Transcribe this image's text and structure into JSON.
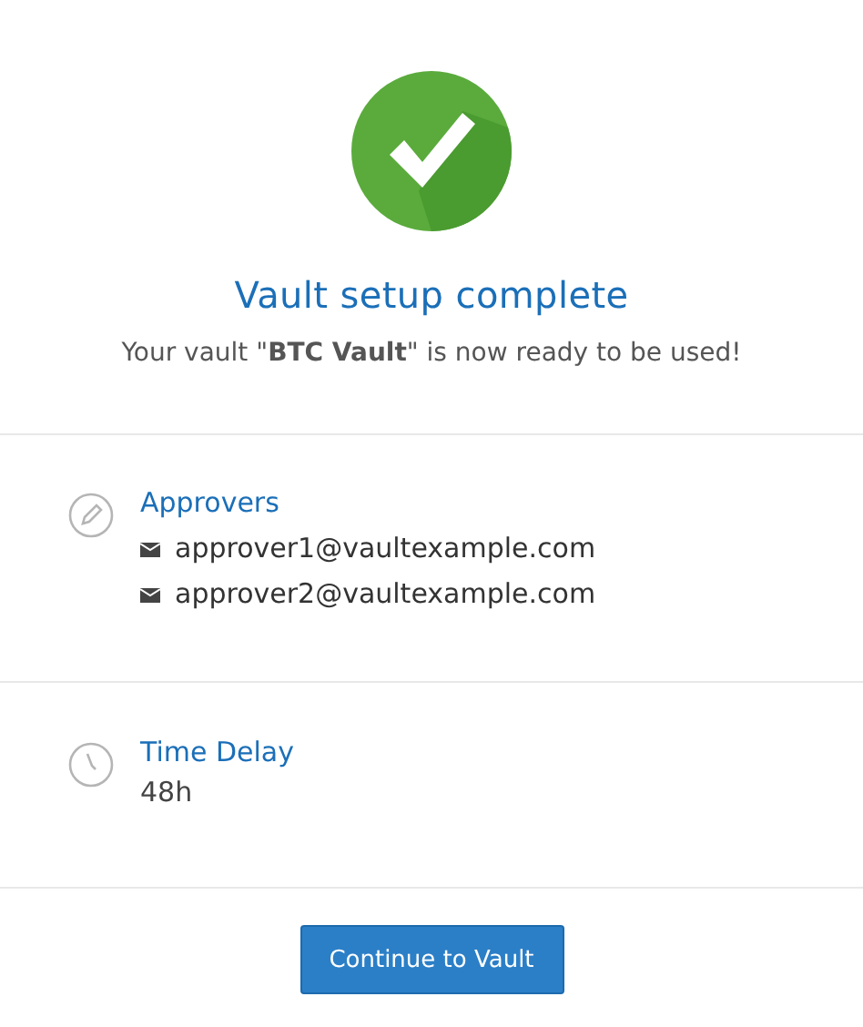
{
  "header": {
    "title": "Vault setup complete",
    "message": "Your vault \"**BTC Vault**\" is now ready to be used!"
  },
  "sections": [
    {
      "kind": "emails",
      "title": "Approvers",
      "items": [
        "approver1@vaultexample.com",
        "approver2@vaultexample.com"
      ]
    },
    {
      "kind": "text",
      "title": "Time Delay",
      "items": [
        "48h"
      ]
    }
  ],
  "button": "Continue to Vault"
}
